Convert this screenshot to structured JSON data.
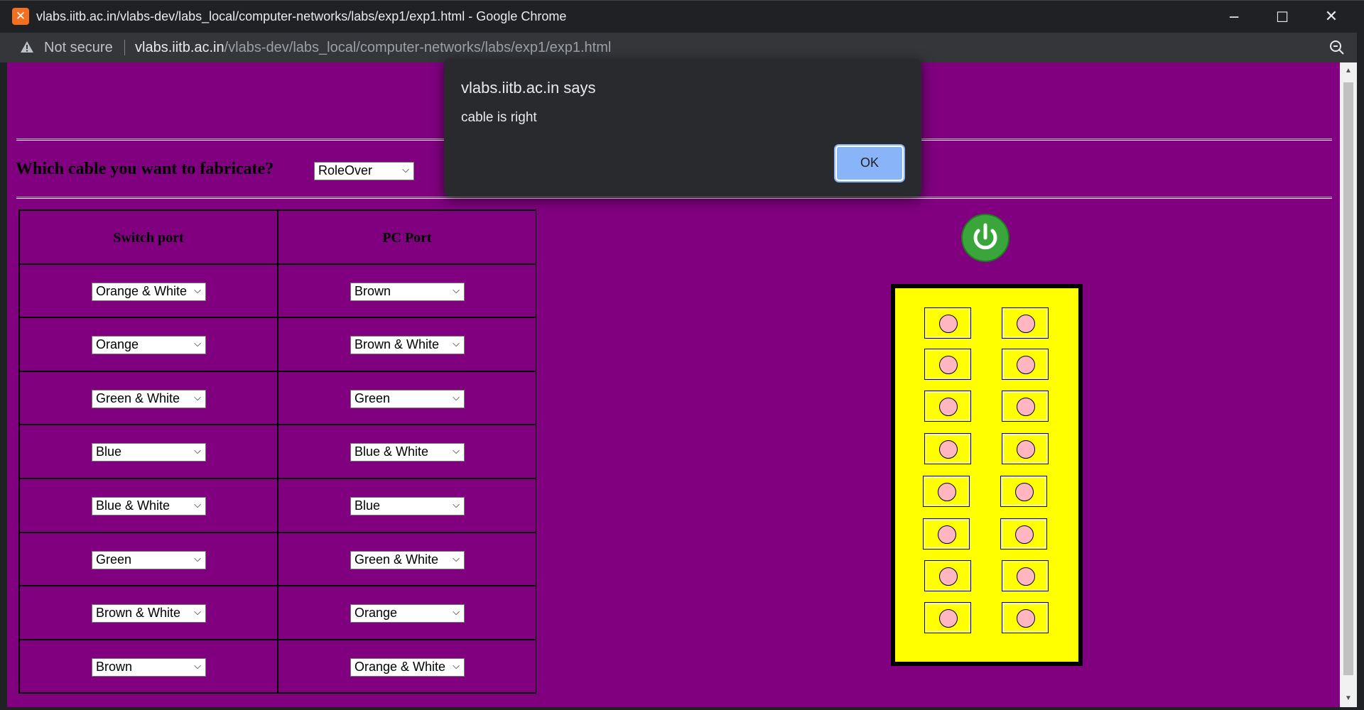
{
  "window": {
    "title": "vlabs.iitb.ac.in/vlabs-dev/labs_local/computer-networks/labs/exp1/exp1.html - Google Chrome",
    "minimize": "─",
    "maximize": "☐",
    "close": "✕"
  },
  "address": {
    "security_label": "Not secure",
    "url_host": "vlabs.iitb.ac.in",
    "url_path": "/vlabs-dev/labs_local/computer-networks/labs/exp1/exp1.html"
  },
  "page": {
    "question": "Which cable you want to fabricate?",
    "cable_type": "RoleOver",
    "table": {
      "headers": [
        "Switch port",
        "PC Port"
      ],
      "rows": [
        {
          "switch": "Orange & White",
          "pc": "Brown"
        },
        {
          "switch": "Orange",
          "pc": "Brown & White"
        },
        {
          "switch": "Green & White",
          "pc": "Green"
        },
        {
          "switch": "Blue",
          "pc": "Blue & White"
        },
        {
          "switch": "Blue & White",
          "pc": "Blue"
        },
        {
          "switch": "Green",
          "pc": "Green & White"
        },
        {
          "switch": "Brown & White",
          "pc": "Orange"
        },
        {
          "switch": "Brown",
          "pc": "Orange & White"
        }
      ]
    },
    "panel_icon": "power-icon",
    "colors": {
      "background": "#800080",
      "panel": "#ffff00",
      "pin": "#ffb6c1",
      "power": "#3aa53a"
    }
  },
  "dialog": {
    "title": "vlabs.iitb.ac.in says",
    "message": "cable is right",
    "ok_label": "OK"
  }
}
